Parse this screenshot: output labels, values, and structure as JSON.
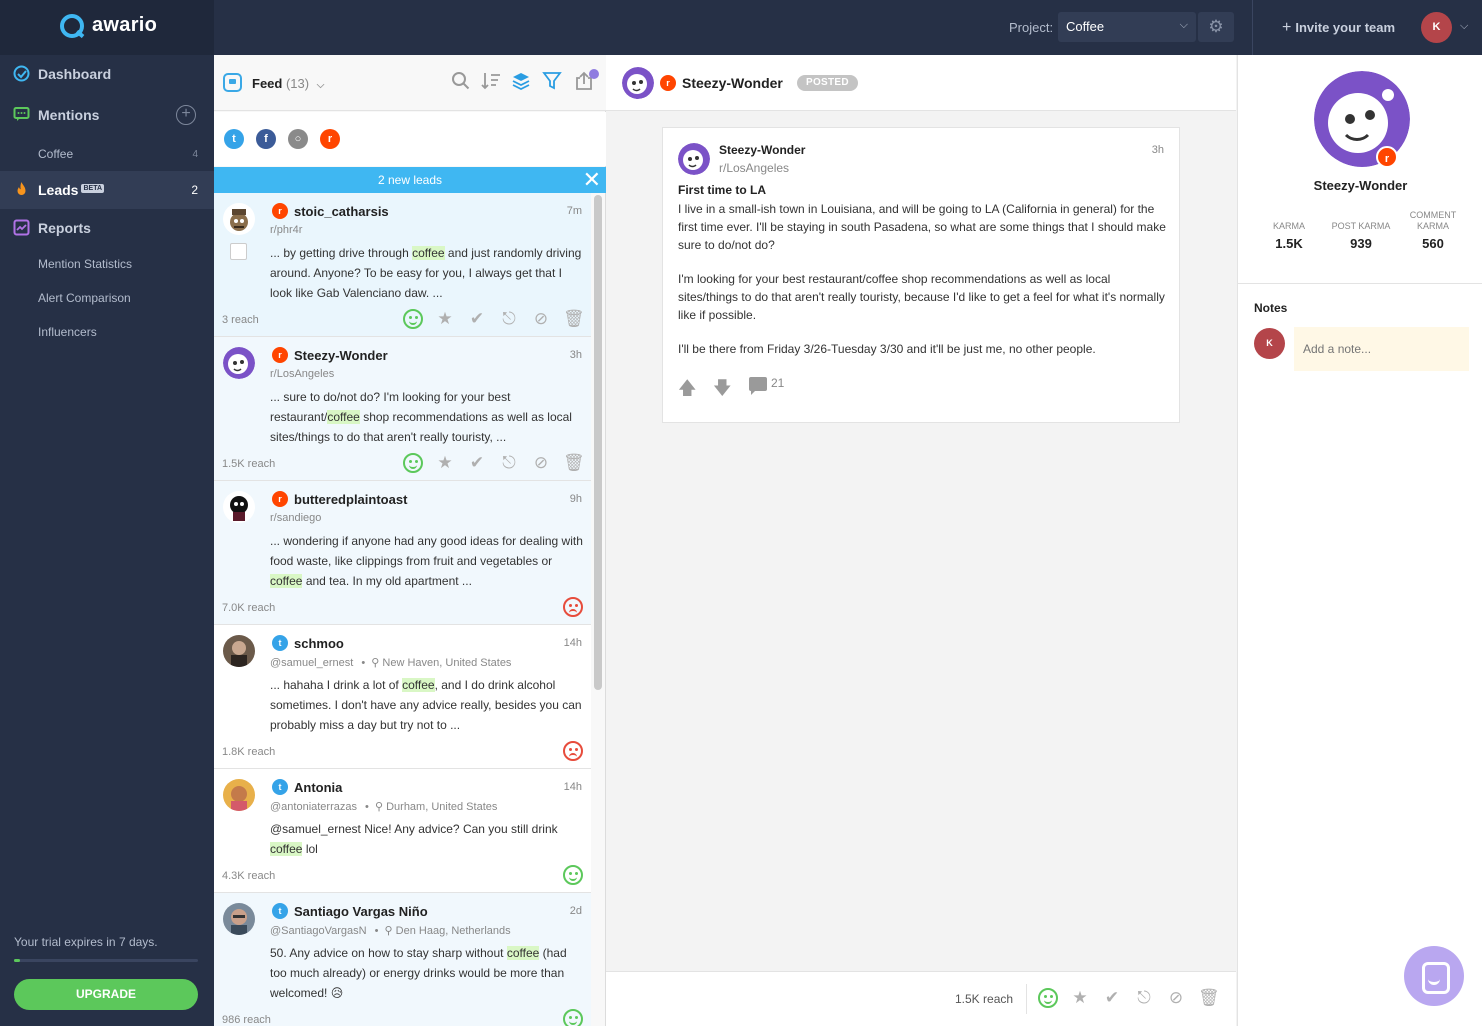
{
  "app": {
    "logo": "awario",
    "project_label": "Project:",
    "project_value": "Coffee",
    "invite_label": "Invite your team",
    "user_initial": "K"
  },
  "sidebar": {
    "dashboard": "Dashboard",
    "mentions": "Mentions",
    "mentions_sub": [
      {
        "label": "Coffee",
        "count": "4"
      }
    ],
    "leads": "Leads",
    "leads_badge": "BETA",
    "leads_count": "2",
    "reports": "Reports",
    "reports_sub": [
      "Mention Statistics",
      "Alert Comparison",
      "Influencers"
    ],
    "trial_text": "Your trial expires in 7 days.",
    "trial_progress": 0.03,
    "upgrade_label": "UPGRADE"
  },
  "feed": {
    "title": "Feed",
    "count": "(13)",
    "banner": "2 new leads",
    "items": [
      {
        "source": "reddit",
        "name": "stoic_catharsis",
        "time": "7m",
        "sub": "r/phr4r",
        "text_before": "... by getting drive through ",
        "keyword": "coffee",
        "text_after": " and just randomly driving around. Anyone? To be easy for you, I always get that I look like Gab Valenciano daw. ...",
        "reach": "3 reach",
        "sentiment": "positive"
      },
      {
        "source": "reddit",
        "name": "Steezy-Wonder",
        "time": "3h",
        "sub": "r/LosAngeles",
        "text_before": "... sure to do/not do? I'm looking for your best restaurant/",
        "keyword": "coffee",
        "text_after": " shop recommendations as well as local sites/things to do that aren't really touristy, ...",
        "reach": "1.5K reach",
        "sentiment": "positive"
      },
      {
        "source": "reddit",
        "name": "butteredplaintoast",
        "time": "9h",
        "sub": "r/sandiego",
        "text_before": "... wondering if anyone had any good ideas for dealing with food waste, like clippings from fruit and vegetables or ",
        "keyword": "coffee",
        "text_after": " and tea. In my old apartment ...",
        "reach": "7.0K reach",
        "sentiment": "negative"
      },
      {
        "source": "twitter",
        "name": "schmoo",
        "time": "14h",
        "sub": "@samuel_ernest",
        "location": "New Haven, United States",
        "text_before": "... hahaha I drink a lot of ",
        "keyword": "coffee",
        "text_after": ", and I do drink alcohol sometimes. I don't have any advice really, besides you can probably miss a day but try not to ...",
        "reach": "1.8K reach",
        "sentiment": "negative"
      },
      {
        "source": "twitter",
        "name": "Antonia",
        "time": "14h",
        "sub": "@antoniaterrazas",
        "location": "Durham, United States",
        "text_before": "@samuel_ernest Nice! Any advice? Can you still drink ",
        "keyword": "coffee",
        "text_after": " lol",
        "reach": "4.3K reach",
        "sentiment": "positive"
      },
      {
        "source": "twitter",
        "name": "Santiago Vargas Niño",
        "time": "2d",
        "sub": "@SantiagoVargasN",
        "location": "Den Haag, Netherlands",
        "text_before": "50. Any advice on how to stay sharp without ",
        "keyword": "coffee",
        "text_after": " (had too much already) or energy drinks would be more than welcomed! 😥",
        "reach": "986 reach",
        "sentiment": "positive"
      }
    ]
  },
  "detail": {
    "author": "Steezy-Wonder",
    "status": "POSTED",
    "sub": "r/LosAngeles",
    "time": "3h",
    "post_title": "First time to LA",
    "paragraphs": [
      "I live in a small-ish town in Louisiana, and will be going to LA (California in general) for the first time ever. I'll be staying in south Pasadena, so what are some things that I should make sure to do/not do?",
      "I'm looking for your best restaurant/coffee shop recommendations as well as local sites/things to do that aren't really touristy, because I'd like to get a feel for what it's normally like if possible.",
      "I'll be there from Friday 3/26-Tuesday 3/30 and it'll be just me, no other people."
    ],
    "comments": "21",
    "reach": "1.5K reach"
  },
  "profile": {
    "name": "Steezy-Wonder",
    "stats": [
      {
        "label": "KARMA",
        "value": "1.5K"
      },
      {
        "label": "POST KARMA",
        "value": "939"
      },
      {
        "label": "COMMENT KARMA",
        "value": "560"
      }
    ],
    "notes_label": "Notes",
    "note_placeholder": "Add a note...",
    "note_user_initial": "K"
  },
  "colors": {
    "sidebar_bg": "#263046",
    "accent_blue": "#3fb7f2",
    "upgrade_green": "#5cc85b",
    "reddit": "#ff4500",
    "twitter": "#35a3e8",
    "keyword_highlight": "#d9f7c5"
  }
}
